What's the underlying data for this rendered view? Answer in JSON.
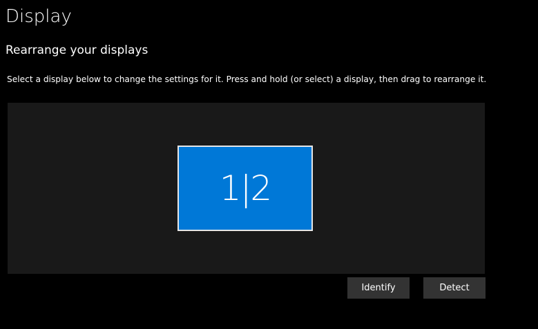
{
  "header": {
    "title": "Display"
  },
  "arrange": {
    "heading": "Rearrange your displays",
    "description": "Select a display below to change the settings for it. Press and hold (or select) a display, then drag to rearrange it.",
    "display_tile": {
      "label": "1|2",
      "selected": true
    },
    "identify_label": "Identify",
    "detect_label": "Detect"
  },
  "colors": {
    "background": "#000000",
    "arrange_area": "#191919",
    "display_tile": "#0078d7",
    "display_tile_border": "#e6e6e6",
    "button": "#333333",
    "text": "#ffffff"
  }
}
